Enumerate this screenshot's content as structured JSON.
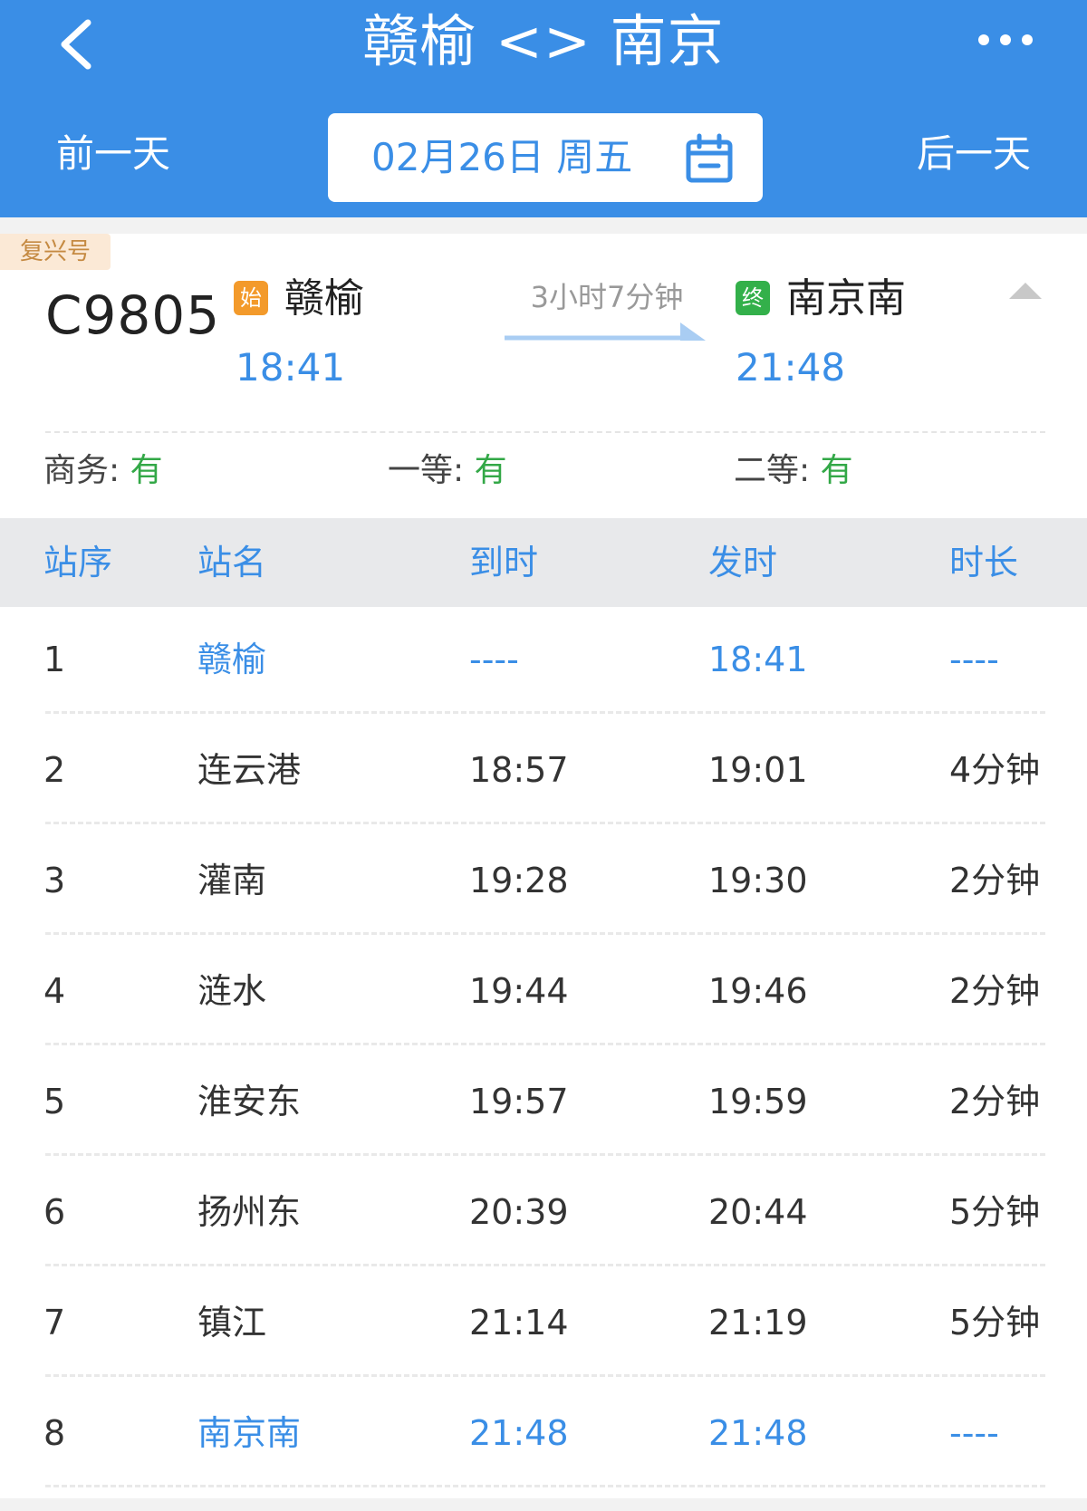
{
  "header": {
    "title": "赣榆 <> 南京",
    "prev_day": "前一天",
    "next_day": "后一天",
    "date": "02月26日 周五",
    "bg_color": "#3a8ee6"
  },
  "icons": {
    "back": "chevron-left-icon",
    "more": "more-dots-icon",
    "calendar": "calendar-icon",
    "collapse": "caret-up-icon"
  },
  "train": {
    "type": "复兴号",
    "number": "C9805",
    "start_badge": "始",
    "end_badge": "终",
    "from_station": "赣榆",
    "to_station": "南京南",
    "depart_time": "18:41",
    "arrive_time": "21:48",
    "duration": "3小时7分钟",
    "seats": [
      {
        "label": "商务:",
        "value": "有"
      },
      {
        "label": "一等:",
        "value": "有"
      },
      {
        "label": "二等:",
        "value": "有"
      }
    ]
  },
  "table": {
    "headers": [
      "站序",
      "站名",
      "到时",
      "发时",
      "时长"
    ],
    "rows": [
      {
        "seq": "1",
        "name": "赣榆",
        "arrive": "----",
        "depart": "18:41",
        "stop": "----",
        "highlight": true
      },
      {
        "seq": "2",
        "name": "连云港",
        "arrive": "18:57",
        "depart": "19:01",
        "stop": "4分钟",
        "highlight": false
      },
      {
        "seq": "3",
        "name": "灌南",
        "arrive": "19:28",
        "depart": "19:30",
        "stop": "2分钟",
        "highlight": false
      },
      {
        "seq": "4",
        "name": "涟水",
        "arrive": "19:44",
        "depart": "19:46",
        "stop": "2分钟",
        "highlight": false
      },
      {
        "seq": "5",
        "name": "淮安东",
        "arrive": "19:57",
        "depart": "19:59",
        "stop": "2分钟",
        "highlight": false
      },
      {
        "seq": "6",
        "name": "扬州东",
        "arrive": "20:39",
        "depart": "20:44",
        "stop": "5分钟",
        "highlight": false
      },
      {
        "seq": "7",
        "name": "镇江",
        "arrive": "21:14",
        "depart": "21:19",
        "stop": "5分钟",
        "highlight": false
      },
      {
        "seq": "8",
        "name": "南京南",
        "arrive": "21:48",
        "depart": "21:48",
        "stop": "----",
        "highlight": true
      }
    ]
  }
}
